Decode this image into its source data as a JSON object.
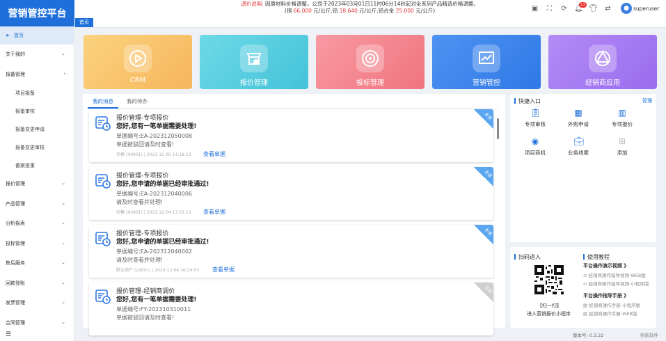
{
  "app": {
    "title": "营销管控平台"
  },
  "notice": {
    "label": "调价说明:",
    "line1": "因原材料价格调整，公司于2023年03月01日11时06分14秒起对全系列产品精选价格调整。",
    "line2_a": "(铜",
    "copper": "66.000",
    "line2_b": "元/公斤,铝",
    "aluminum": "18.640",
    "line2_c": "元/公斤,铝合金",
    "alloy": "25.000",
    "line2_d": "元/公斤)"
  },
  "header": {
    "notification_count": "13",
    "username": "superuser"
  },
  "tabs": {
    "home": "首页"
  },
  "sidebar": {
    "items": [
      {
        "label": "首页"
      },
      {
        "label": "关于我的"
      },
      {
        "label": "报备管理"
      },
      {
        "label": "项目报备"
      },
      {
        "label": "报备审核"
      },
      {
        "label": "报备变更申请"
      },
      {
        "label": "报备变更审核"
      },
      {
        "label": "备案查重"
      },
      {
        "label": "报价管理"
      },
      {
        "label": "产品管理"
      },
      {
        "label": "分析报表"
      },
      {
        "label": "投标管理"
      },
      {
        "label": "售后服务"
      },
      {
        "label": "回款登账"
      },
      {
        "label": "发票管理"
      },
      {
        "label": "合同管理"
      }
    ]
  },
  "cards": [
    {
      "label": "CRM",
      "color": "#f9c36e"
    },
    {
      "label": "报价管理",
      "color": "#55cde0"
    },
    {
      "label": "投标管理",
      "color": "#f58a94"
    },
    {
      "label": "营销管控",
      "color": "#3d86ef"
    },
    {
      "label": "经销商应用",
      "color": "#a77cf3"
    }
  ],
  "messages": {
    "tab_my": "我的消息",
    "tab_todo": "我的待办",
    "list": [
      {
        "title": "报价管理-专项报价",
        "headline": "您好,您有一笔单据需要处理!",
        "doc": "单据编号:EA-202312050008",
        "desc": "单据被驳回请及时查看!",
        "meta": "孙蓉 (X0901) | 2023-12-05 14:18:13",
        "link": "查看单据",
        "tag": "未读"
      },
      {
        "title": "报价管理-专项报价",
        "headline": "您好,您申请的单据已经审批通过!",
        "doc": "单据编号:EA-202312040006",
        "desc": "请及时查看并处理!",
        "meta": "孙蓉 (X0901) | 2023-12-04 17:03:13",
        "link": "查看单据",
        "tag": "未读"
      },
      {
        "title": "报价管理-专项报价",
        "headline": "您好,您申请的单据已经审批通过!",
        "doc": "单据编号:EA-202312040002",
        "desc": "请及时查看并处理!",
        "meta": "默认用户 (LX001) | 2023-12-04 16:24:03",
        "link": "查看单据",
        "tag": "未读"
      },
      {
        "title": "报价管理-经销商调价",
        "headline": "您好,您有一笔单据需要处理!",
        "doc": "单据编号:FY-202310310011",
        "desc": "单据被驳回请及时查看!",
        "meta": "",
        "link": "",
        "tag": "已读"
      }
    ]
  },
  "quick": {
    "title": "快捷入口",
    "manage": "管理",
    "items": [
      {
        "label": "专项审核",
        "icon": "clipboard-check-icon"
      },
      {
        "label": "外购申请",
        "icon": "grid-icon"
      },
      {
        "label": "专项报价",
        "icon": "books-icon"
      },
      {
        "label": "项目商机",
        "icon": "target-icon"
      },
      {
        "label": "业务线索",
        "icon": "briefcase-icon"
      },
      {
        "label": "添加",
        "icon": "plus-icon"
      }
    ]
  },
  "scan": {
    "title": "扫码进入",
    "caption1": "【扫一扫】",
    "caption2": "进入营销报价小程序"
  },
  "tutorial": {
    "title": "使用教程",
    "video_heading": "平台操作演示视频 》",
    "video_items": [
      "经销商操作指导视频-WEB版",
      "经销商操作指导视频-小程序版"
    ],
    "manual_heading": "平台操作指导手册 》",
    "manual_items": [
      "经销商操作手册-小程序版",
      "经销商操作手册-WEB版"
    ]
  },
  "footer": {
    "version": "版本号: 0.3.22",
    "company": "稻新软件"
  }
}
